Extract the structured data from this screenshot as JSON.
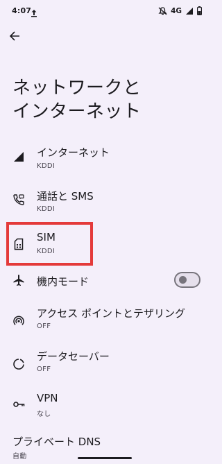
{
  "status_bar": {
    "time": "4:07",
    "network": "4G"
  },
  "header": {
    "back_icon": "arrow-back-icon"
  },
  "page": {
    "title_line1": "ネットワークと",
    "title_line2": "インターネット"
  },
  "items": [
    {
      "id": "internet",
      "icon": "signal-icon",
      "label": "インターネット",
      "sub": "KDDI"
    },
    {
      "id": "calls-sms",
      "icon": "phone-sms-icon",
      "label": "通話と SMS",
      "sub": "KDDI"
    },
    {
      "id": "sim",
      "icon": "sim-card-icon",
      "label": "SIM",
      "sub": "KDDI"
    },
    {
      "id": "airplane",
      "icon": "airplane-icon",
      "label": "機内モード",
      "toggle_on": false
    },
    {
      "id": "hotspot",
      "icon": "hotspot-icon",
      "label": "アクセス ポイントとテザリング",
      "sub": "OFF"
    },
    {
      "id": "data-saver",
      "icon": "data-saver-icon",
      "label": "データセーバー",
      "sub": "OFF"
    },
    {
      "id": "vpn",
      "icon": "key-icon",
      "label": "VPN",
      "sub": "なし"
    },
    {
      "id": "private-dns",
      "label": "プライベート DNS",
      "sub": "自動"
    }
  ],
  "colors": {
    "background": "#f4effa",
    "highlight": "#e43a3a"
  }
}
